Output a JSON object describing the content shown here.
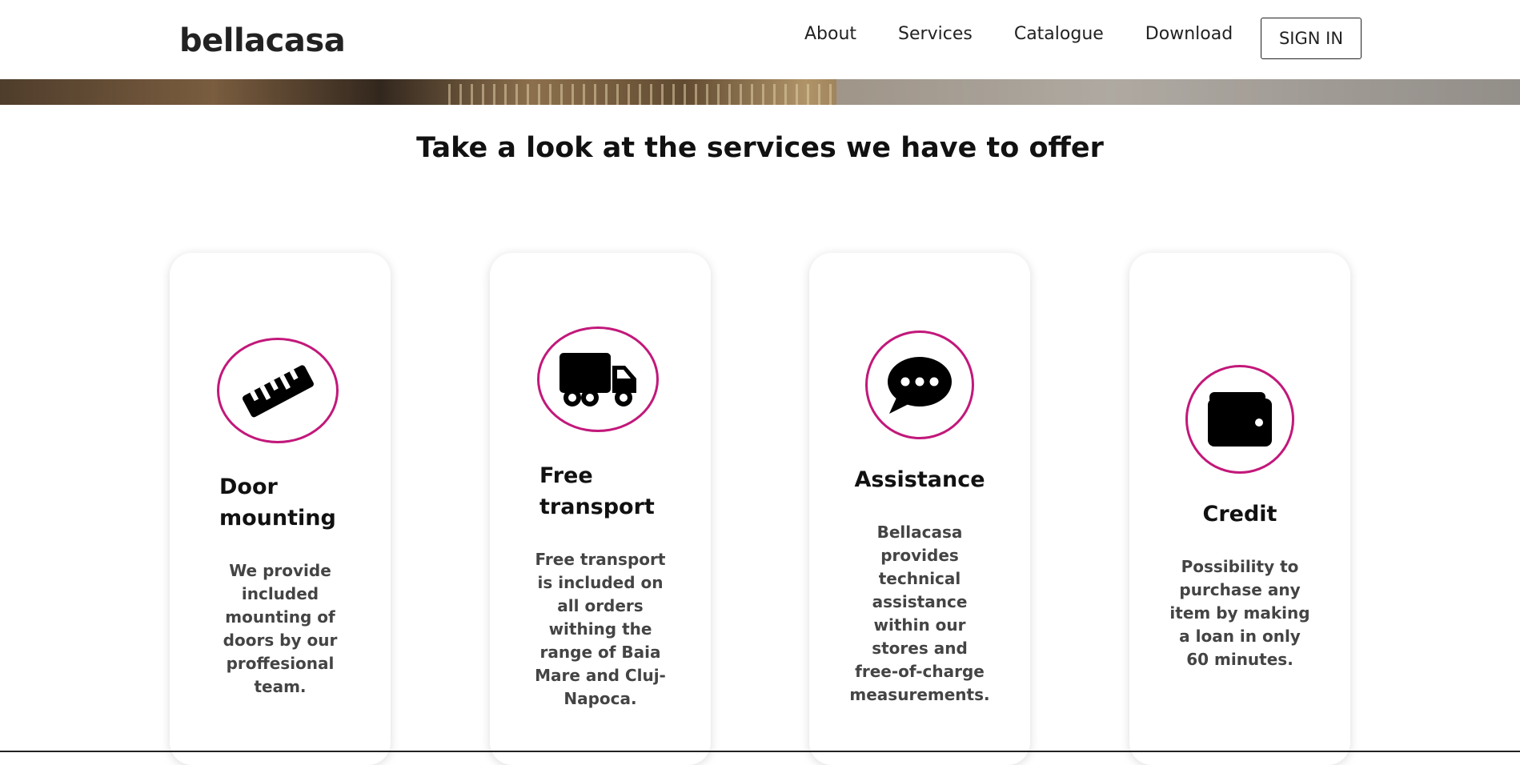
{
  "header": {
    "logo": "bellacasa",
    "nav": [
      "About",
      "Services",
      "Catalogue",
      "Download"
    ],
    "sign_in": "SIGN IN"
  },
  "section": {
    "title": "Take a look at the services we have to offer"
  },
  "services": [
    {
      "icon": "ruler-icon",
      "title_line1": "Door",
      "title_line2": "mounting",
      "text_lines": [
        "We provide",
        "included",
        "mounting of",
        "doors by our",
        "proffesional",
        "team."
      ]
    },
    {
      "icon": "truck-icon",
      "title_line1": "Free",
      "title_line2": "transport",
      "text_lines": [
        "Free transport",
        "is included on",
        "all orders",
        "withing the",
        "range of Baia",
        "Mare and Cluj-",
        "Napoca."
      ]
    },
    {
      "icon": "chat-bubble-icon",
      "title_line1": "Assistance",
      "text_lines": [
        "Bellacasa",
        "provides",
        "technical",
        "assistance",
        "within our",
        "stores and",
        "free-of-charge",
        "measurements."
      ]
    },
    {
      "icon": "wallet-icon",
      "title_line1": "Credit",
      "text_lines": [
        "Possibility to",
        "purchase any",
        "item by making",
        "a loan in only",
        "60 minutes."
      ]
    }
  ],
  "colors": {
    "accent": "#c2187a",
    "text": "#111111",
    "body_text": "#444444"
  }
}
